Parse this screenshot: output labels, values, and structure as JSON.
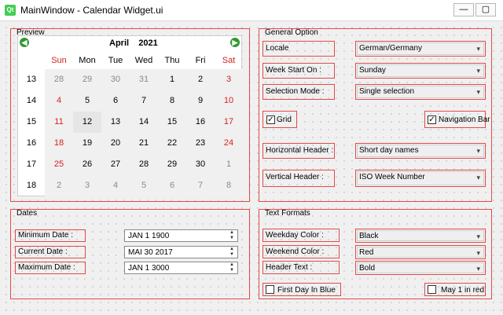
{
  "window": {
    "title": "MainWindow - Calendar Widget.ui",
    "icon_text": "Qt",
    "buttons": [
      "—",
      "▢",
      "✕"
    ]
  },
  "preview": {
    "title": "Preview",
    "calendar": {
      "month": "April",
      "year": "2021",
      "weekday_headers": [
        "Sun",
        "Mon",
        "Tue",
        "Wed",
        "Thu",
        "Fri",
        "Sat"
      ],
      "week_numbers": [
        "13",
        "14",
        "15",
        "16",
        "17",
        "18"
      ],
      "rows": [
        [
          "28",
          "29",
          "30",
          "31",
          "1",
          "2",
          "3"
        ],
        [
          "4",
          "5",
          "6",
          "7",
          "8",
          "9",
          "10"
        ],
        [
          "11",
          "12",
          "13",
          "14",
          "15",
          "16",
          "17"
        ],
        [
          "18",
          "19",
          "20",
          "21",
          "22",
          "23",
          "24"
        ],
        [
          "25",
          "26",
          "27",
          "28",
          "29",
          "30",
          "1"
        ],
        [
          "2",
          "3",
          "4",
          "5",
          "6",
          "7",
          "8"
        ]
      ],
      "selected": {
        "row": 2,
        "col": 1
      }
    }
  },
  "general": {
    "title": "General Option",
    "locale_label": "Locale",
    "locale_value": "German/Germany",
    "week_start_label": "Week Start On :",
    "week_start_value": "Sunday",
    "selection_mode_label": "Selection Mode :",
    "selection_mode_value": "Single selection",
    "grid_label": "Grid",
    "grid_checked": true,
    "nav_bar_label": "Navigation Bar",
    "nav_bar_checked": true,
    "h_header_label": "Horizontal Header :",
    "h_header_value": "Short day names",
    "v_header_label": "Vertical Header :",
    "v_header_value": "ISO Week Number"
  },
  "dates": {
    "title": "Dates",
    "min_label": "Minimum Date :",
    "min_value": "JAN 1 1900",
    "cur_label": "Current Date :",
    "cur_value": "MAI 30 2017",
    "max_label": "Maximum Date :",
    "max_value": "JAN 1 3000"
  },
  "text_formats": {
    "title": "Text Formats",
    "weekday_label": "Weekday Color :",
    "weekday_value": "Black",
    "weekend_label": "Weekend Color :",
    "weekend_value": "Red",
    "header_label": "Header Text :",
    "header_value": "Bold",
    "first_day_label": "First Day In Blue",
    "first_day_checked": false,
    "may1_label": "May 1 in red",
    "may1_checked": false
  },
  "colors": {
    "accent_red": "#e24a4a",
    "weekend_red": "#d61f1f",
    "nav_green": "#2e9a2e"
  }
}
